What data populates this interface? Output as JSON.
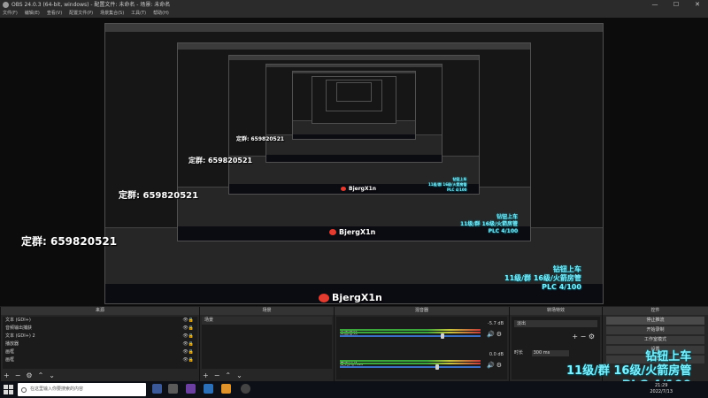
{
  "window": {
    "title": "OBS 24.0.3 (64-bit, windows) - 配置文件: 未命名 - 场景: 未命名"
  },
  "menu": [
    "文件(F)",
    "编辑(E)",
    "查看(V)",
    "配置文件(P)",
    "场景集合(S)",
    "工具(T)",
    "帮助(H)"
  ],
  "overlay": {
    "group_label": "定群: 659820521",
    "handle": "BjergX1n",
    "promo_line1": "钻钮上车",
    "promo_line2": "11级/群 16级/火箭房管",
    "promo_line3": "PLC 4/100"
  },
  "docks": {
    "sources": {
      "title": "来源",
      "items": [
        "文本 (GDI+)",
        "音频输出捕获",
        "文本 (GDI+) 2",
        "播放器",
        "画框",
        "画框"
      ]
    },
    "scenes": {
      "title": "场景",
      "items": [
        "场景"
      ]
    },
    "mixer": {
      "title": "混音器",
      "channels": [
        {
          "name": "桌面音频",
          "db": "-5.7 dB",
          "level": 0.72
        },
        {
          "name": "麦克风/Aux",
          "db": "0.0 dB",
          "level": 0.68
        }
      ]
    },
    "transitions": {
      "title": "转场特效",
      "selected": "淡出",
      "duration_label": "时长",
      "duration_value": "300 ms"
    },
    "controls": {
      "title": "控件",
      "buttons": [
        "停止推流",
        "开始录制",
        "工作室模式",
        "设置",
        "退出"
      ]
    }
  },
  "taskbar": {
    "search_placeholder": "在这里输入你要搜索的内容",
    "time": "21:29",
    "date": "2022/7/13"
  },
  "colors": {
    "promo": "#7ff0ff",
    "weibo": "#e23b2f",
    "meter_green": "#3aa83a",
    "slider_blue": "#3a6fc8"
  }
}
